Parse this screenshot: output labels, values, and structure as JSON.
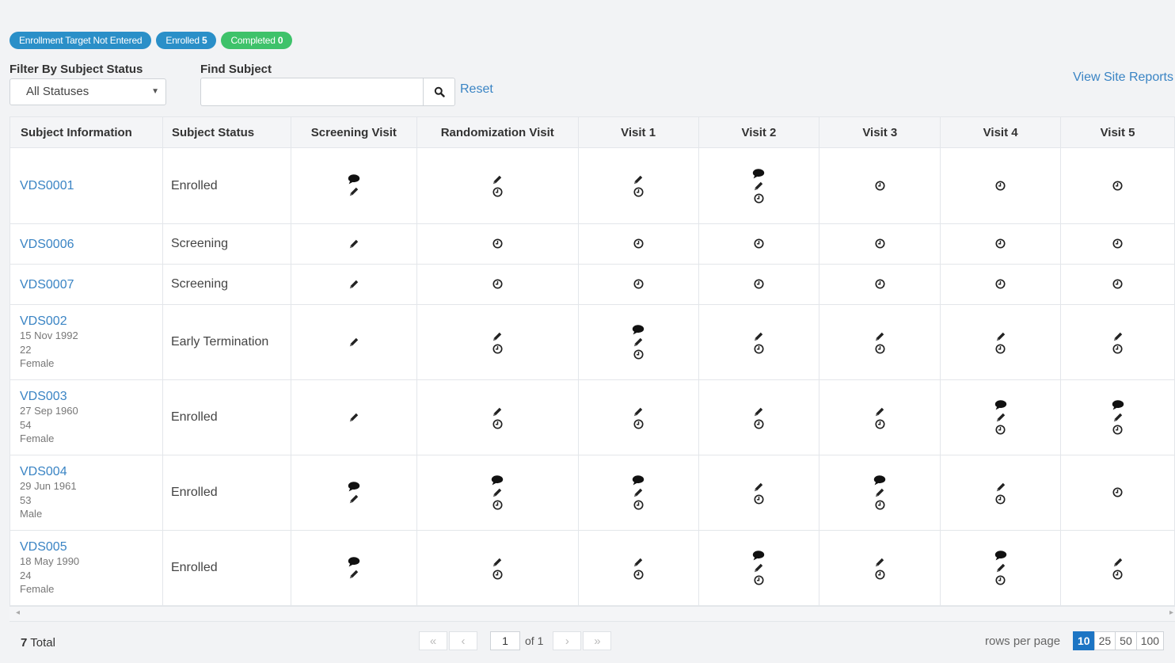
{
  "badges": [
    {
      "label": "Enrollment Target Not Entered",
      "count": "",
      "color": "#2a8fc8"
    },
    {
      "label": "Enrolled",
      "count": "5",
      "color": "#2a8fc8"
    },
    {
      "label": "Completed",
      "count": "0",
      "color": "#3ec26a"
    }
  ],
  "filter": {
    "label": "Filter By Subject Status",
    "selected": "All Statuses"
  },
  "find": {
    "label": "Find Subject",
    "value": "",
    "reset": "Reset"
  },
  "site_reports": "View Site Reports",
  "columns": [
    "Subject Information",
    "Subject Status",
    "Screening Visit",
    "Randomization Visit",
    "Visit 1",
    "Visit 2",
    "Visit 3",
    "Visit 4",
    "Visit 5"
  ],
  "rows": [
    {
      "id": "VDS0001",
      "details": [],
      "status": "Enrolled",
      "visits": [
        [
          "comment-icon",
          "pencil-icon"
        ],
        [
          "pencil-icon",
          "clock-icon"
        ],
        [
          "pencil-icon",
          "clock-icon"
        ],
        [
          "comment-icon",
          "pencil-icon",
          "clock-icon"
        ],
        [
          "clock-icon"
        ],
        [
          "clock-icon"
        ],
        [
          "clock-icon"
        ]
      ]
    },
    {
      "id": "VDS0006",
      "details": [],
      "status": "Screening",
      "visits": [
        [
          "pencil-icon"
        ],
        [
          "clock-icon"
        ],
        [
          "clock-icon"
        ],
        [
          "clock-icon"
        ],
        [
          "clock-icon"
        ],
        [
          "clock-icon"
        ],
        [
          "clock-icon"
        ]
      ]
    },
    {
      "id": "VDS0007",
      "details": [],
      "status": "Screening",
      "visits": [
        [
          "pencil-icon"
        ],
        [
          "clock-icon"
        ],
        [
          "clock-icon"
        ],
        [
          "clock-icon"
        ],
        [
          "clock-icon"
        ],
        [
          "clock-icon"
        ],
        [
          "clock-icon"
        ]
      ]
    },
    {
      "id": "VDS002",
      "details": [
        "15 Nov 1992",
        "22",
        "Female"
      ],
      "status": "Early Termination",
      "visits": [
        [
          "pencil-icon"
        ],
        [
          "pencil-icon",
          "clock-icon"
        ],
        [
          "comment-icon",
          "pencil-icon",
          "clock-icon"
        ],
        [
          "pencil-icon",
          "clock-icon"
        ],
        [
          "pencil-icon",
          "clock-icon"
        ],
        [
          "pencil-icon",
          "clock-icon"
        ],
        [
          "pencil-icon",
          "clock-icon"
        ]
      ]
    },
    {
      "id": "VDS003",
      "details": [
        "27 Sep 1960",
        "54",
        "Female"
      ],
      "status": "Enrolled",
      "visits": [
        [
          "pencil-icon"
        ],
        [
          "pencil-icon",
          "clock-icon"
        ],
        [
          "pencil-icon",
          "clock-icon"
        ],
        [
          "pencil-icon",
          "clock-icon"
        ],
        [
          "pencil-icon",
          "clock-icon"
        ],
        [
          "comment-icon",
          "pencil-icon",
          "clock-icon"
        ],
        [
          "comment-icon",
          "pencil-icon",
          "clock-icon"
        ]
      ]
    },
    {
      "id": "VDS004",
      "details": [
        "29 Jun 1961",
        "53",
        "Male"
      ],
      "status": "Enrolled",
      "visits": [
        [
          "comment-icon",
          "pencil-icon"
        ],
        [
          "comment-icon",
          "pencil-icon",
          "clock-icon"
        ],
        [
          "comment-icon",
          "pencil-icon",
          "clock-icon"
        ],
        [
          "pencil-icon",
          "clock-icon"
        ],
        [
          "comment-icon",
          "pencil-icon",
          "clock-icon"
        ],
        [
          "pencil-icon",
          "clock-icon"
        ],
        [
          "clock-icon"
        ]
      ]
    },
    {
      "id": "VDS005",
      "details": [
        "18 May 1990",
        "24",
        "Female"
      ],
      "status": "Enrolled",
      "visits": [
        [
          "comment-icon",
          "pencil-icon"
        ],
        [
          "pencil-icon",
          "clock-icon"
        ],
        [
          "pencil-icon",
          "clock-icon"
        ],
        [
          "comment-icon",
          "pencil-icon",
          "clock-icon"
        ],
        [
          "pencil-icon",
          "clock-icon"
        ],
        [
          "comment-icon",
          "pencil-icon",
          "clock-icon"
        ],
        [
          "pencil-icon",
          "clock-icon"
        ]
      ]
    }
  ],
  "footer": {
    "total_count": "7",
    "total_label": "Total",
    "page": "1",
    "of_label": "of 1",
    "rows_label": "rows per page",
    "rows_options": [
      "10",
      "25",
      "50",
      "100"
    ],
    "rows_selected": "10"
  }
}
